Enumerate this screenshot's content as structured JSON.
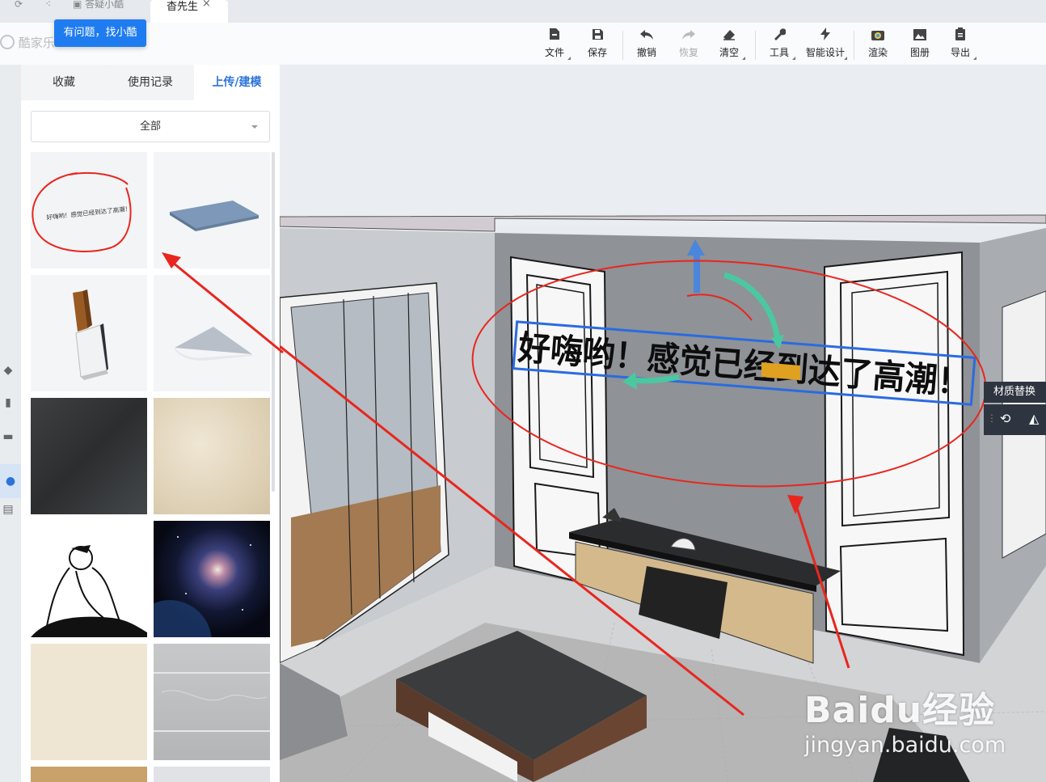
{
  "tabs": [
    {
      "label": "答疑小酷",
      "active": false
    },
    {
      "label": "杳先生",
      "active": true,
      "close": "×"
    }
  ],
  "help_tip": "有问题，找小酷",
  "logo_text": "酷家乐",
  "toolbar": [
    {
      "label": "文件",
      "icon": "file-icon",
      "enabled": true
    },
    {
      "label": "保存",
      "icon": "save-icon",
      "enabled": true
    },
    {
      "label": "撤销",
      "icon": "undo-icon",
      "enabled": true
    },
    {
      "label": "恢复",
      "icon": "redo-icon",
      "enabled": false
    },
    {
      "label": "清空",
      "icon": "eraser-icon",
      "enabled": true
    },
    {
      "label": "工具",
      "icon": "wrench-icon",
      "enabled": true
    },
    {
      "label": "智能设计",
      "icon": "lightning-icon",
      "enabled": true
    },
    {
      "label": "渲染",
      "icon": "render-icon",
      "enabled": true
    },
    {
      "label": "图册",
      "icon": "album-icon",
      "enabled": true
    },
    {
      "label": "导出",
      "icon": "export-icon",
      "enabled": true
    }
  ],
  "panel": {
    "tabs": [
      "收藏",
      "使用记录",
      "上传/建模"
    ],
    "active_tab": "上传/建模",
    "filter_value": "全部"
  },
  "thumbnails": [
    {
      "name": "text-model-thumbnail",
      "text": "好嗨哟！感觉已经到达了高潮！"
    },
    {
      "name": "blue-plate-thumbnail"
    },
    {
      "name": "wood-corner-thumbnail"
    },
    {
      "name": "triangle-plate-thumbnail"
    },
    {
      "name": "dark-fabric-thumbnail"
    },
    {
      "name": "beige-paper-thumbnail"
    },
    {
      "name": "sketch-figure-thumbnail"
    },
    {
      "name": "galaxy-thumbnail"
    },
    {
      "name": "linen-thumbnail"
    },
    {
      "name": "marble-tile-thumbnail"
    }
  ],
  "scene": {
    "wall_text": "好嗨哟！感觉已经到达了高潮！"
  },
  "context_menu": {
    "title": "材质替换"
  },
  "watermark": {
    "main": "Baidu经验",
    "sub": "jingyan.baidu.com"
  },
  "colors": {
    "accent": "#1f7cf0",
    "annotation": "#e8261e",
    "wall": "#8f9296"
  }
}
